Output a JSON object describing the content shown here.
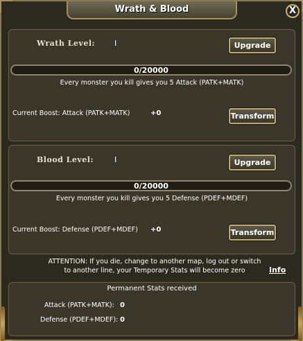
{
  "window": {
    "title": "Wrath & Blood",
    "close_label": "X"
  },
  "wrath": {
    "level_label": "Wrath Level:",
    "level_value": "I",
    "upgrade_label": "Upgrade",
    "progress_text": "0/20000",
    "description": "Every monster you kill gives you 5 Attack (PATK+MATK)",
    "boost_label": "Current Boost: Attack (PATK+MATK)",
    "boost_value": "+0",
    "transform_label": "Transform"
  },
  "blood": {
    "level_label": "Blood Level:",
    "level_value": "I",
    "upgrade_label": "Upgrade",
    "progress_text": "0/20000",
    "description": "Every monster you kill gives you 5 Defense (PDEF+MDEF)",
    "boost_label": "Current Boost: Defense (PDEF+MDEF)",
    "boost_value": "+0",
    "transform_label": "Transform"
  },
  "attention": {
    "line1": "ATTENTION: If you die, change to another map, log out or switch",
    "line2": "to another line, your Temporary Stats will become zero",
    "info_label": "Info"
  },
  "permanent": {
    "title": "Permanent Stats received",
    "attack_label": "Attack (PATK+MATK):",
    "attack_value": "0",
    "defense_label": "Defense (PDEF+MDEF):",
    "defense_value": "0"
  }
}
